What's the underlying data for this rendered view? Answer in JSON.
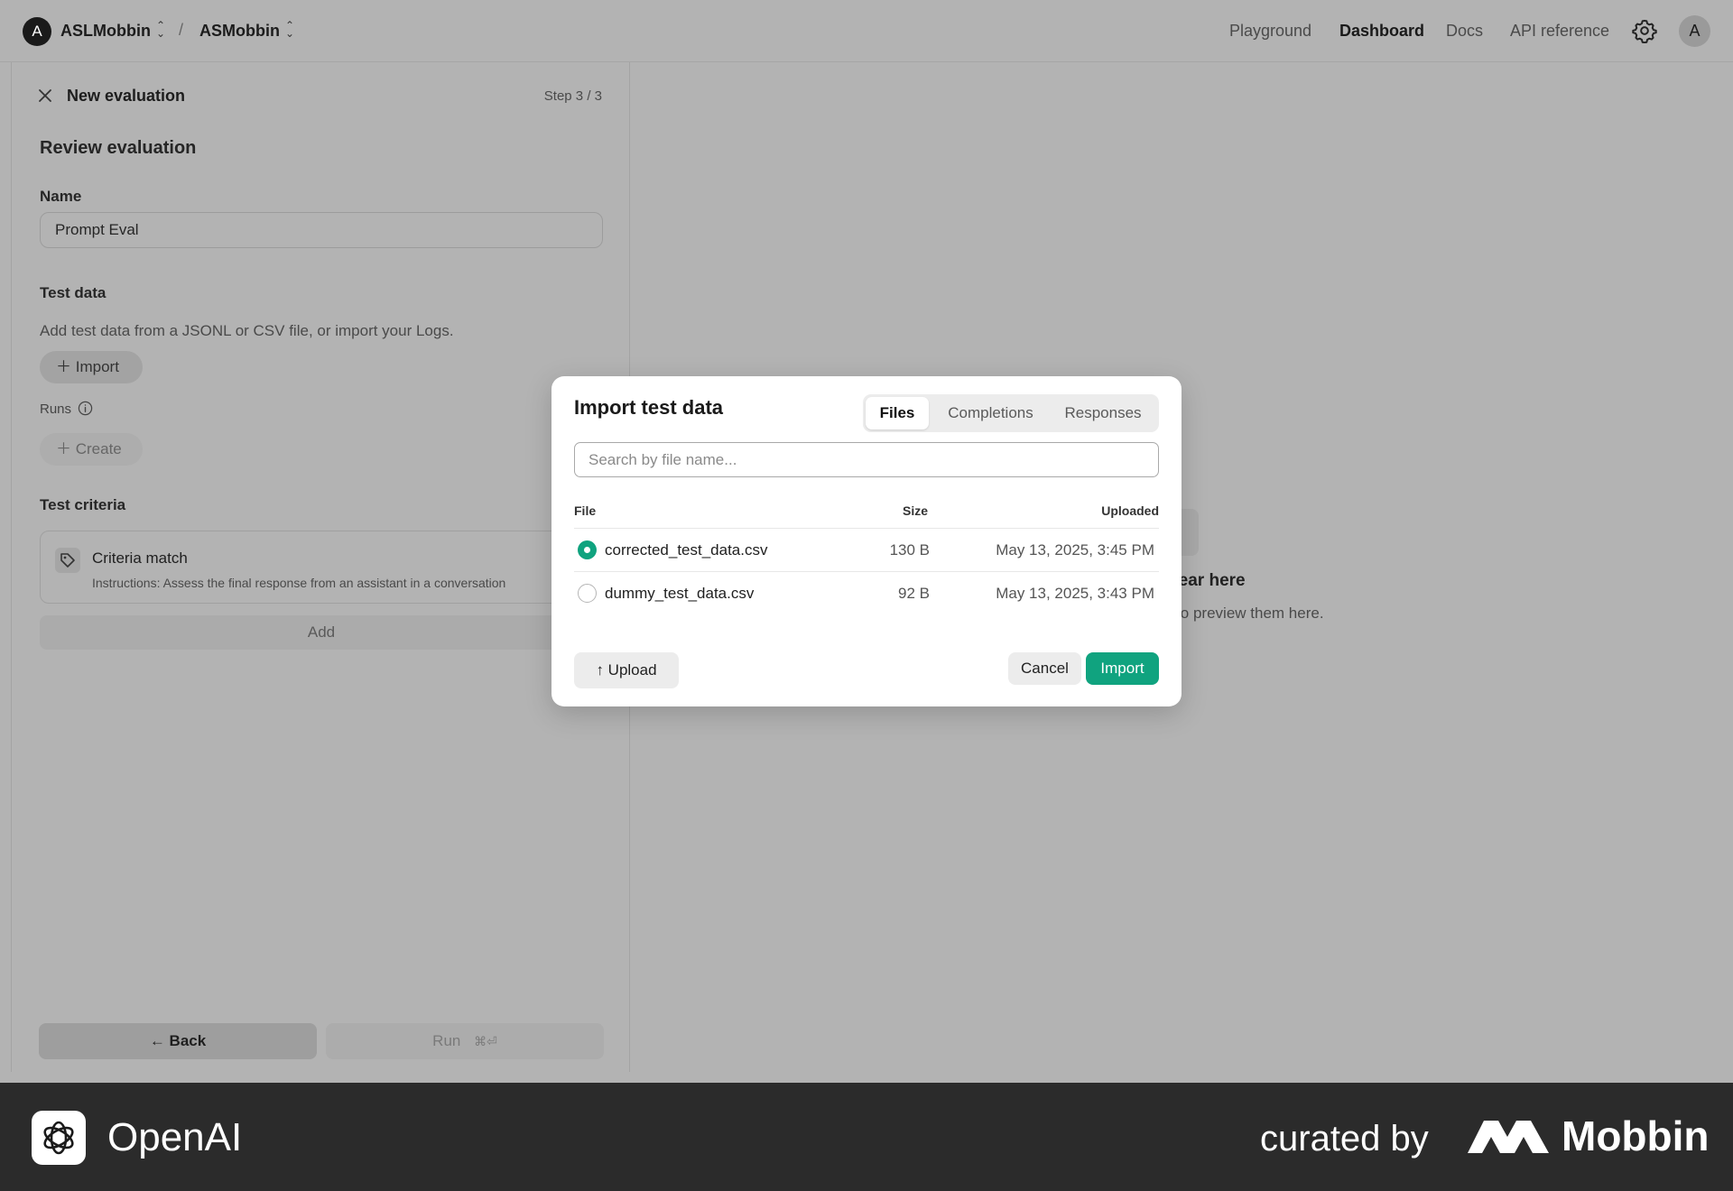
{
  "topbar": {
    "org_initial": "A",
    "org_name": "ASLMobbin",
    "separator": "/",
    "project_name": "ASMobbin",
    "nav": [
      {
        "label": "Playground"
      },
      {
        "label": "Dashboard"
      },
      {
        "label": "Docs"
      },
      {
        "label": "API reference"
      }
    ],
    "active_nav": "Dashboard",
    "user_initial": "A"
  },
  "panel": {
    "title": "New evaluation",
    "step": "Step 3 / 3",
    "heading": "Review evaluation",
    "name_label": "Name",
    "name_value": "Prompt Eval",
    "test_data_label": "Test data",
    "test_data_desc": "Add test data from a JSONL or CSV file, or import your Logs.",
    "import_label": "Import",
    "runs_label": "Runs",
    "create_label": "Create",
    "criteria_label": "Test criteria",
    "criteria": {
      "title": "Criteria match",
      "instructions": "Instructions: Assess the final response from an assistant in a conversation"
    },
    "add_label": "Add",
    "back_label": "Back",
    "run_label": "Run",
    "run_shortcut": "⌘⏎"
  },
  "empty_state": {
    "title_fragment": "will appear here",
    "subtitle_fragment": "st cases to preview them here."
  },
  "modal": {
    "title": "Import test data",
    "tabs": [
      "Files",
      "Completions",
      "Responses"
    ],
    "active_tab": "Files",
    "search_placeholder": "Search by file name...",
    "columns": {
      "file": "File",
      "size": "Size",
      "uploaded": "Uploaded"
    },
    "files": [
      {
        "name": "corrected_test_data.csv",
        "size": "130 B",
        "uploaded": "May 13, 2025, 3:45 PM",
        "selected": true
      },
      {
        "name": "dummy_test_data.csv",
        "size": "92 B",
        "uploaded": "May 13, 2025, 3:43 PM",
        "selected": false
      }
    ],
    "upload_label": "Upload",
    "cancel_label": "Cancel",
    "import_label": "Import",
    "accent_color": "#10a37f"
  },
  "footer": {
    "brand": "OpenAI",
    "curated_by": "curated by",
    "curator": "Mobbin"
  }
}
